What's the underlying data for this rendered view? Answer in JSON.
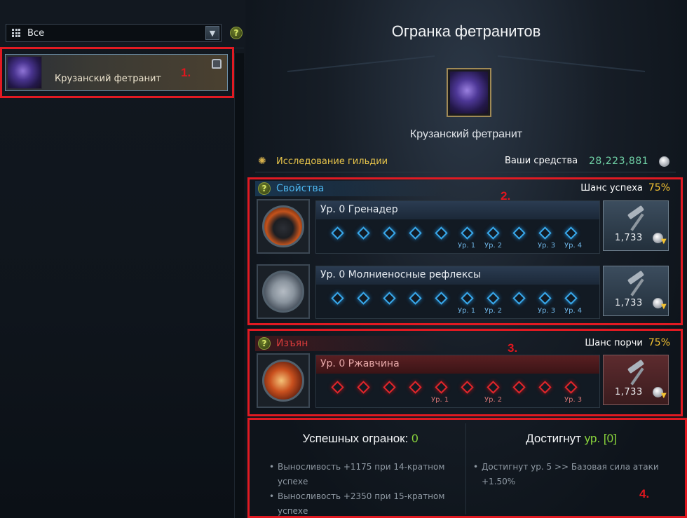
{
  "filter": {
    "label": "Все",
    "chevron_icon": "chevron-down-icon",
    "help": "?"
  },
  "list": {
    "items": [
      {
        "name": "Крузанский фетранит",
        "icon": "feitrunite-gem-icon"
      }
    ]
  },
  "main": {
    "title": "Огранка фетранитов",
    "gem_name": "Крузанский фетранит",
    "guild_research": "Исследование гильдии",
    "funds_label": "Ваши средства",
    "funds_value": "28,223,881"
  },
  "properties": {
    "help": "?",
    "title": "Свойства",
    "chance_label": "Шанс успеха",
    "chance_value": "75%",
    "rows": [
      {
        "name": "Ур. 0 Гренадер",
        "cost": "1,733",
        "icon": "grenadier-skill-icon",
        "levels": [
          "Ур. 1",
          "Ур. 2",
          "Ур. 3",
          "Ур. 4"
        ],
        "slots": 10
      },
      {
        "name": "Ур. 0 Молниеносные рефлексы",
        "cost": "1,733",
        "icon": "lightning-reflexes-skill-icon",
        "levels": [
          "Ур. 1",
          "Ур. 2",
          "Ур. 3",
          "Ур. 4"
        ],
        "slots": 10
      }
    ]
  },
  "flaw": {
    "help": "?",
    "title": "Изъян",
    "chance_label": "Шанс порчи",
    "chance_value": "75%",
    "rows": [
      {
        "name": "Ур. 0 Ржавчина",
        "cost": "1,733",
        "icon": "rust-debuff-icon",
        "levels": [
          "Ур. 1",
          "Ур. 2",
          "Ур. 3"
        ],
        "slots": 10
      }
    ]
  },
  "summary": {
    "success_label": "Успешных огранок:",
    "success_value": "0",
    "success_bullets": [
      "Выносливость +1175 при 14-кратном успехе",
      "Выносливость +2350 при 15-кратном успехе"
    ],
    "reached_label": "Достигнут",
    "reached_value": "ур. [0]",
    "reached_bullets": [
      "Достигнут ур. 5 >> Базовая сила атаки +1.50%"
    ]
  },
  "annotations": [
    "1.",
    "2.",
    "3.",
    "4."
  ],
  "colors": {
    "annotation": "#e11a22",
    "prop_blue": "#39a8ea",
    "flaw_red": "#e0262b",
    "gold": "#f3c232",
    "funds_green": "#6fd0a5"
  }
}
